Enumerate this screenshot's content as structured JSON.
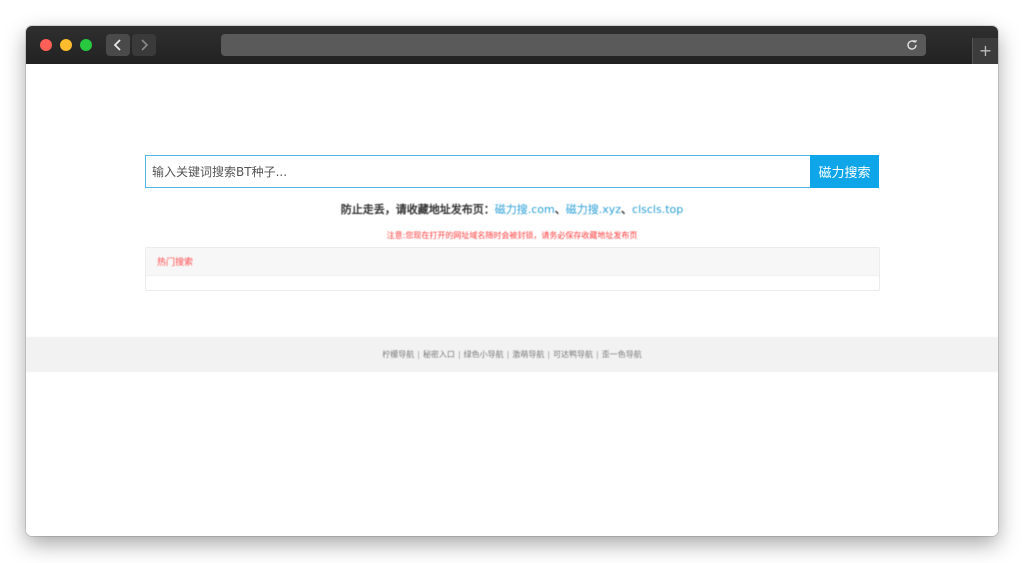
{
  "browser": {
    "back_icon": "chevron-left-icon",
    "forward_icon": "chevron-right-icon",
    "reload_icon": "reload-icon",
    "new_tab_icon": "plus-icon",
    "new_tab_label": "+"
  },
  "search": {
    "placeholder": "输入关键词搜索BT种子...",
    "button_label": "磁力搜索"
  },
  "notice": {
    "prefix": "防止走丢，请收藏地址发布页：",
    "links": [
      "磁力搜.com",
      "磁力搜.xyz",
      "clscls.top"
    ],
    "separator": "、",
    "warning": "注意:您现在打开的网址域名随时会被封锁，请务必保存收藏地址发布页"
  },
  "hot": {
    "title": "热门搜索"
  },
  "footer": {
    "links": [
      "柠檬导航",
      "秘密入口",
      "绿色小导航",
      "激萌导航",
      "可达鸭导航",
      "歪一色导航"
    ],
    "separator": "|"
  },
  "colors": {
    "accent": "#0ea5e9",
    "input_border": "#4fb8e6",
    "warning": "#ff3b3b",
    "link": "#2a9fd6"
  }
}
